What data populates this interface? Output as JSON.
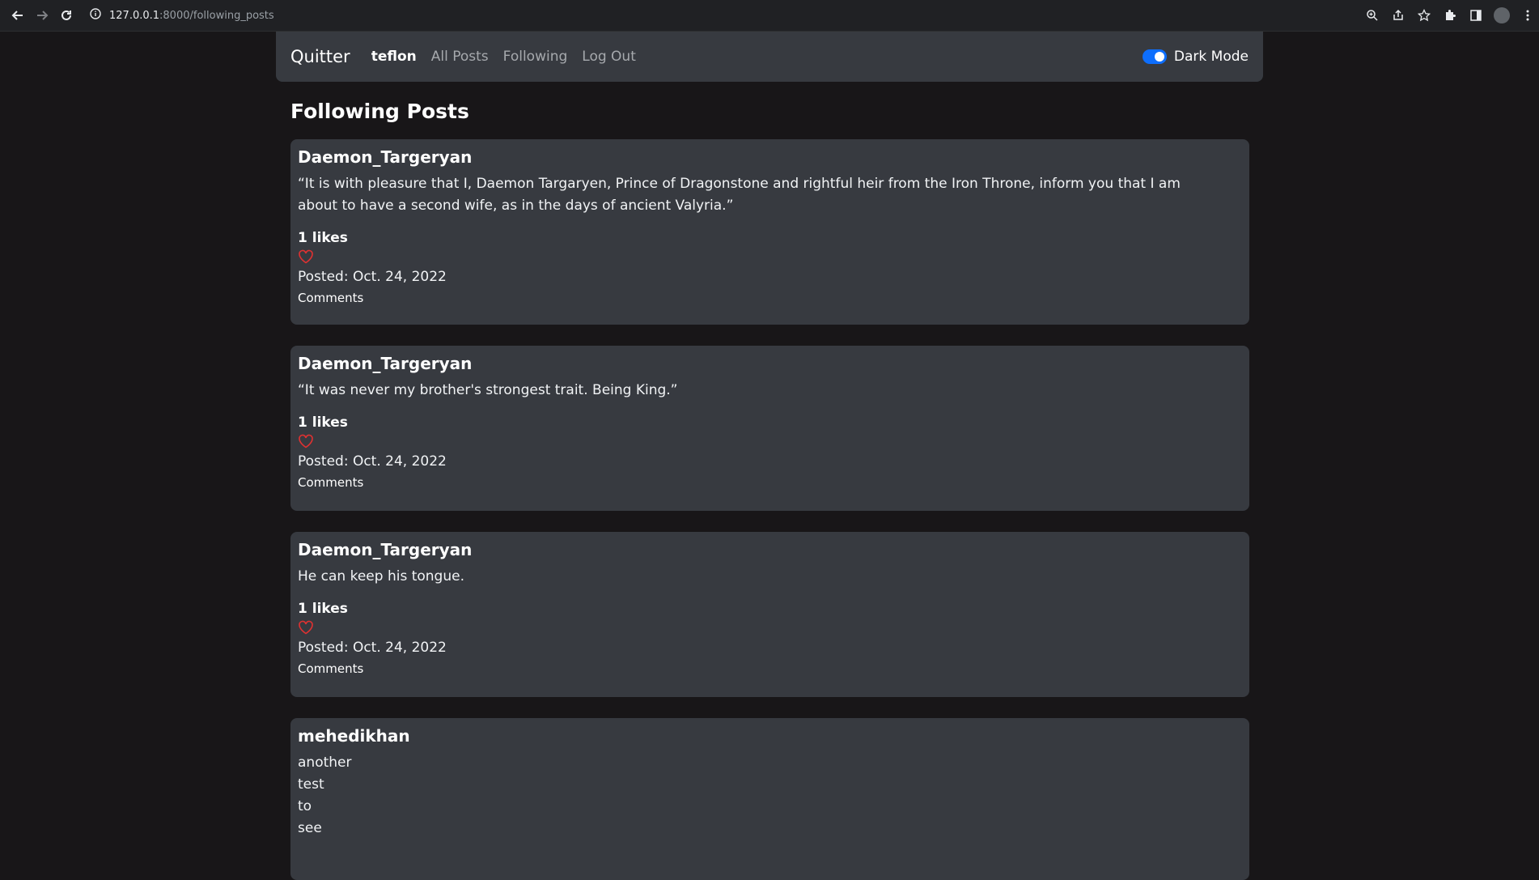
{
  "browser": {
    "url_host": "127.0.0.1",
    "url_path": ":8000/following_posts"
  },
  "navbar": {
    "brand": "Quitter",
    "links": [
      {
        "label": "teflon",
        "active": true
      },
      {
        "label": "All Posts",
        "active": false
      },
      {
        "label": "Following",
        "active": false
      },
      {
        "label": "Log Out",
        "active": false
      }
    ],
    "dark_mode_label": "Dark Mode",
    "dark_mode_on": true
  },
  "page": {
    "title": "Following Posts"
  },
  "posts": [
    {
      "author": "Daemon_Targeryan",
      "body": "“It is with pleasure that I, Daemon Targaryen, Prince of Dragonstone and rightful heir from the Iron Throne, inform you that I am about to have a second wife, as in the days of ancient Valyria.”",
      "likes": "1 likes",
      "posted": "Posted: Oct. 24, 2022",
      "comments": "Comments"
    },
    {
      "author": "Daemon_Targeryan",
      "body": "“It was never my brother's strongest trait. Being King.”",
      "likes": "1 likes",
      "posted": "Posted: Oct. 24, 2022",
      "comments": "Comments"
    },
    {
      "author": "Daemon_Targeryan",
      "body": "He can keep his tongue.",
      "likes": "1 likes",
      "posted": "Posted: Oct. 24, 2022",
      "comments": "Comments"
    },
    {
      "author": "mehedikhan",
      "body_lines": [
        "another",
        "test",
        "to",
        "see"
      ]
    }
  ],
  "colors": {
    "background": "#181618",
    "card": "#373a40",
    "toggle_accent": "#0d6efd",
    "heart": "#e03131"
  },
  "icons": [
    "back-arrow-icon",
    "forward-arrow-icon",
    "reload-icon",
    "info-icon",
    "zoom-icon",
    "share-icon",
    "star-icon",
    "extensions-icon",
    "sidebar-icon",
    "heart-icon"
  ]
}
